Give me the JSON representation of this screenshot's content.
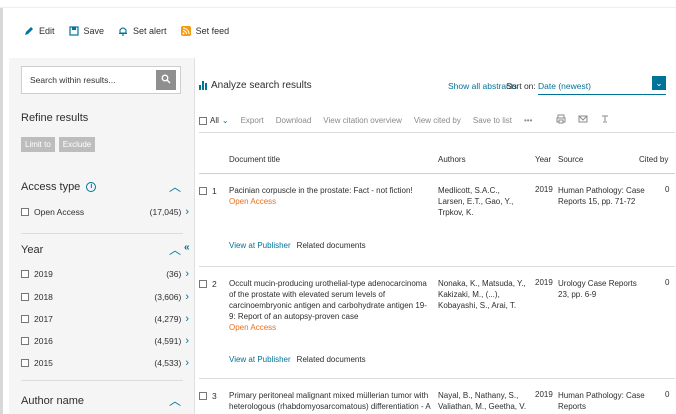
{
  "toolbar": {
    "edit": "Edit",
    "save": "Save",
    "set_alert": "Set alert",
    "set_feed": "Set feed"
  },
  "left": {
    "search_placeholder": "Search within results...",
    "refine_title": "Refine results",
    "limit_to": "Limit to",
    "exclude": "Exclude",
    "access": {
      "title": "Access type",
      "items": [
        {
          "label": "Open Access",
          "count": "(17,045)"
        }
      ]
    },
    "year": {
      "title": "Year",
      "items": [
        {
          "label": "2019",
          "count": "(36)"
        },
        {
          "label": "2018",
          "count": "(3,606)"
        },
        {
          "label": "2017",
          "count": "(4,279)"
        },
        {
          "label": "2016",
          "count": "(4,591)"
        },
        {
          "label": "2015",
          "count": "(4,533)"
        }
      ]
    },
    "author": {
      "title": "Author name"
    }
  },
  "main": {
    "analyze": "Analyze search results",
    "show_abstracts": "Show all abstracts",
    "sort_on": "Sort on:",
    "sort_value": "Date (newest)",
    "all": "All",
    "actions": [
      "Export",
      "Download",
      "View citation overview",
      "View cited by",
      "Save to list",
      "•••"
    ],
    "columns": {
      "title": "Document title",
      "authors": "Authors",
      "year": "Year",
      "source": "Source",
      "cited": "Cited by"
    },
    "results": [
      {
        "num": "1",
        "title": "Pacinian corpuscle in the prostate: Fact - not fiction!",
        "oa": "Open Access",
        "authors": "Medlicott, S.A.C., Larsen, E.T., Gao, Y., Trpkov, K.",
        "year": "2019",
        "source": "Human Pathology: Case Reports 15, pp. 71-72",
        "cited": "0",
        "view_publisher": "View at Publisher",
        "related": "Related documents"
      },
      {
        "num": "2",
        "title": "Occult mucin-producing urothelial-type adenocarcinoma of the prostate with elevated serum levels of carcinoembryonic antigen and carbohydrate antigen 19-9: Report of an autopsy-proven case",
        "oa": "Open Access",
        "authors": "Nonaka, K., Matsuda, Y., Kakizaki, M., (...), Kobayashi, S., Arai, T.",
        "year": "2019",
        "source": "Urology Case Reports 23, pp. 6-9",
        "cited": "0",
        "view_publisher": "View at Publisher",
        "related": "Related documents"
      },
      {
        "num": "3",
        "title": "Primary peritoneal malignant mixed müllerian tumor with heterologous (rhabdomyosarcomatous) differentiation - A",
        "authors": "Nayal, B., Nathany, S., Valiathan, M., Geetha, V.",
        "year": "2019",
        "source": "Human Pathology: Case Reports",
        "cited": "0"
      }
    ]
  }
}
